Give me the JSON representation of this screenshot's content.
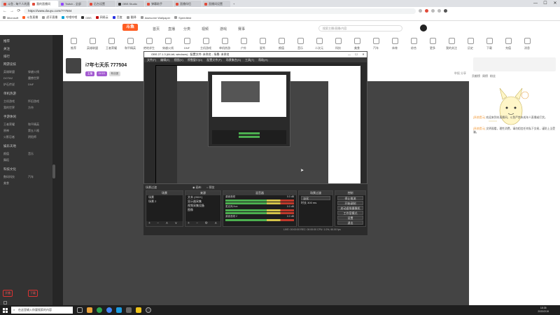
{
  "browser": {
    "tabs": [
      {
        "label": "斗鱼 - 每个人的直播",
        "active": false
      },
      {
        "label": "我的直播间",
        "active": true
      },
      {
        "label": "Twitch - 全部",
        "active": false
      },
      {
        "label": "后台设置",
        "active": false
      },
      {
        "label": "OBS Studio",
        "active": false
      },
      {
        "label": "弹幕助手",
        "active": false
      },
      {
        "label": "直播伴侣",
        "active": false
      },
      {
        "label": "直播间设置",
        "active": false
      }
    ],
    "url": "https://www.douyu.com/777504",
    "bookmarks": [
      "Microsoft",
      "斗鱼直播",
      "虎牙直播",
      "哔哩哔哩",
      "OBS",
      "网易云",
      "百度",
      "翻译",
      "Awesome Wallpaper",
      "Speedtest"
    ],
    "window_controls": {
      "min": "—",
      "max": "☐",
      "close": "✕"
    }
  },
  "site": {
    "logo": "斗鱼",
    "nav": [
      "首页",
      "直播",
      "分类",
      "视频",
      "游戏",
      "赛事"
    ],
    "search_placeholder": "搜索主播/直播/内容",
    "categories": [
      "推荐",
      "英雄联盟",
      "王者荣耀",
      "和平精英",
      "绝地求生",
      "穿越火线",
      "DNF",
      "主机游戏",
      "单机热游",
      "户外",
      "星秀",
      "颜值",
      "音乐",
      "二次元",
      "科技",
      "美食",
      "汽车",
      "体育",
      "综合",
      "更多",
      "我的关注",
      "历史",
      "下载",
      "充值",
      "消息"
    ]
  },
  "leftbar": {
    "sections": [
      {
        "head": "推荐",
        "items": []
      },
      {
        "head": "关注",
        "items": []
      },
      {
        "head": "排行",
        "items": []
      },
      {
        "head": "网游竞技",
        "items": [
          "英雄联盟",
          "穿越火线",
          "DOTA2",
          "魔兽世界",
          "炉石传说",
          "DNF"
        ]
      },
      {
        "head": "单机热游",
        "items": [
          "主机游戏",
          "怀旧游戏",
          "我的世界",
          "方舟"
        ]
      },
      {
        "head": "手游休闲",
        "items": [
          "王者荣耀",
          "和平精英",
          "原神",
          "第五人格",
          "火影忍者",
          "阴阳师"
        ]
      },
      {
        "head": "娱乐天地",
        "items": [
          "颜值",
          "音乐",
          "舞蹈"
        ]
      },
      {
        "head": "科技文化",
        "items": [
          "数码科技",
          "汽车",
          "美食"
        ]
      }
    ],
    "bottom_buttons": [
      "开播",
      "下载"
    ]
  },
  "streamer": {
    "room_title": "i7年七天乐 777504",
    "tags": [
      "主播",
      "LV.19",
      "粉丝团"
    ],
    "right_text": "举报  分享"
  },
  "obs": {
    "title": "OBS 27.1.3 (64-bit, windows) - 配置文件: 未命名 - 场景: 未命名",
    "menu": [
      "文件(F)",
      "编辑(E)",
      "视图(V)",
      "停靠窗口(D)",
      "配置文件(P)",
      "场景集合(S)",
      "工具(T)",
      "帮助(H)"
    ],
    "docks_label": "场景过渡",
    "preview_labels": [
      "画布",
      "预览"
    ],
    "scenes": {
      "title": "场景",
      "items": [
        "场景",
        "场景 2"
      ]
    },
    "sources": {
      "title": "来源",
      "items": [
        "文本 (GDI+)",
        "显示器采集",
        "视频采集设备",
        "图像"
      ]
    },
    "mixer": {
      "title": "混音器",
      "channels": [
        {
          "name": "桌面音频",
          "db": "0.0 dB"
        },
        {
          "name": "麦克风/Aux",
          "db": "0.0 dB"
        },
        {
          "name": "桌面音频 2",
          "db": "0.0 dB"
        }
      ]
    },
    "transitions": {
      "title": "场景过渡",
      "type": "淡化",
      "duration_label": "时长",
      "duration": "300 ms"
    },
    "controls": {
      "title": "控制",
      "buttons": [
        "停止推流",
        "开始录制",
        "启动虚拟摄像机",
        "工作室模式",
        "设置",
        "退出"
      ]
    },
    "status": "LIVE: 00:00:00   REC: 00:00:00   CPU: 1.0%, 60.00 fps"
  },
  "rightbar": {
    "tabs": [
      "贡献榜",
      "周榜",
      "粉丝"
    ],
    "chat": [
      {
        "user": "[系统提示]",
        "text": "欢迎来到本直播间，斗鱼严禁未成年人直播或打赏。"
      },
      {
        "user": "[系统提示]",
        "text": "文明观看，理性消费，请勿相信任何私下交易，谨防上当受骗。"
      }
    ]
  },
  "taskbar": {
    "search_placeholder": "在这里输入你要搜索的内容",
    "time": "18:35",
    "date": "2022/2/19"
  },
  "colors": {
    "accent": "#ff5d23",
    "purple": "#a45bd1",
    "obs_bg": "#2a2a2a"
  }
}
